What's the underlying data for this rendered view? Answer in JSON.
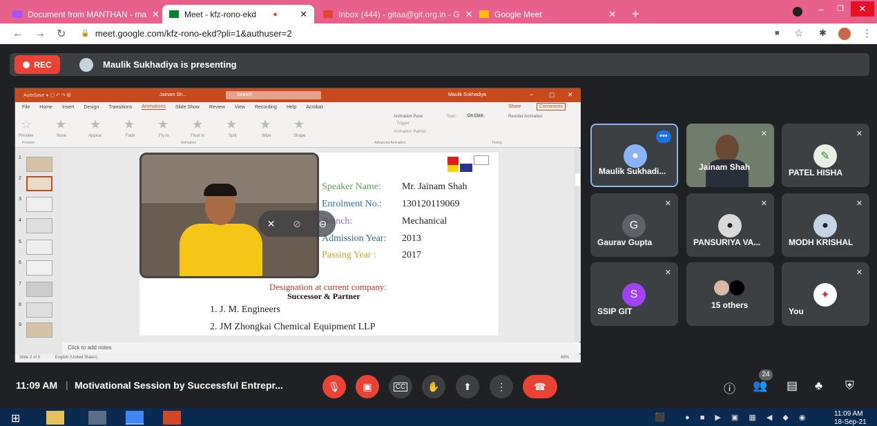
{
  "browser": {
    "tabs": [
      {
        "title": "Document from MANTHAN - ma",
        "fav_color": "#a855f7"
      },
      {
        "title": "Meet - kfz-rono-ekd",
        "fav_color": "#00832d"
      },
      {
        "title": "Inbox (444) - gitaa@git.org.in - G",
        "fav_color": "#ea4335"
      },
      {
        "title": "Google Meet",
        "fav_color": "#fbbc04"
      }
    ],
    "new_tab": "+",
    "url": "meet.google.com/kfz-rono-ekd?pli=1&authuser=2"
  },
  "meet": {
    "rec_label": "REC",
    "presenting_text": "Maulik Sukhadiya is presenting",
    "clock": "11:09 AM",
    "separator": "|",
    "meeting_title": "Motivational Session by Successful Entrepr...",
    "participant_count": "24"
  },
  "ppt": {
    "title_center": "Jainam Sh...",
    "search": "Search",
    "user": "Maulik Sukhadiya",
    "menu": [
      "File",
      "Home",
      "Insert",
      "Design",
      "Transitions",
      "Animations",
      "Slide Show",
      "Review",
      "View",
      "Recording",
      "Help",
      "Acrobat"
    ],
    "share": "Share",
    "comments": "Comments",
    "animations": [
      "None",
      "Appear",
      "Fade",
      "Fly In",
      "Float In",
      "Split",
      "Wipe",
      "Shape"
    ],
    "preview": "Preview",
    "group_animation": "Animation",
    "group_advanced": "Advanced Animation",
    "group_timing": "Timing",
    "anim_pane": "Animation Pane",
    "trigger": "Trigger",
    "anim_painter": "Animation Painter",
    "start_label": "Start:",
    "start_value": "On Click",
    "reorder": "Reorder Animation",
    "thumb_numbers": [
      "1",
      "2",
      "3",
      "4",
      "5",
      "6",
      "7",
      "8",
      "9"
    ],
    "slide": {
      "labels": [
        "Speaker Name:",
        "Enrolment No.:",
        "Branch:",
        "Admission Year:",
        "Passing Year :"
      ],
      "values": [
        "Mr. Jainam Shah",
        "130120119069",
        "Mechanical",
        "2013",
        "2017"
      ],
      "designation": "Designation at current company:",
      "role": "Successor & Partner",
      "companies": [
        "1.  J. M. Engineers",
        "2.  JM Zhongkai Chemical Equipment LLP"
      ]
    },
    "notes_placeholder": "Click to add notes",
    "status_left": "Slide 2 of 9",
    "status_lang": "English (United States)",
    "zoom": "68%"
  },
  "participants": [
    {
      "name": "Maulik Sukhadi...",
      "type": "avatar",
      "color": "#8ab4f8"
    },
    {
      "name": "Jainam Shah",
      "type": "video",
      "color": "#7a6e62"
    },
    {
      "name": "PATEL HISHA",
      "type": "avatar",
      "color": "#e8f0e4"
    },
    {
      "name": "Gaurav Gupta",
      "type": "letter",
      "letter": "G",
      "color": "#5f6368"
    },
    {
      "name": "PANSURIYA VA...",
      "type": "avatar",
      "color": "#d9d9d9"
    },
    {
      "name": "MODH KRISHAL",
      "type": "avatar",
      "color": "#c3d4e6"
    },
    {
      "name": "SSIP GIT",
      "type": "letter",
      "letter": "S",
      "color": "#a142f4"
    },
    {
      "name": "15 others",
      "type": "group",
      "color": "#000000"
    },
    {
      "name": "You",
      "type": "avatar",
      "color": "#ffffff"
    }
  ],
  "taskbar": {
    "time": "11:09 AM",
    "date": "18-Sep-21"
  }
}
